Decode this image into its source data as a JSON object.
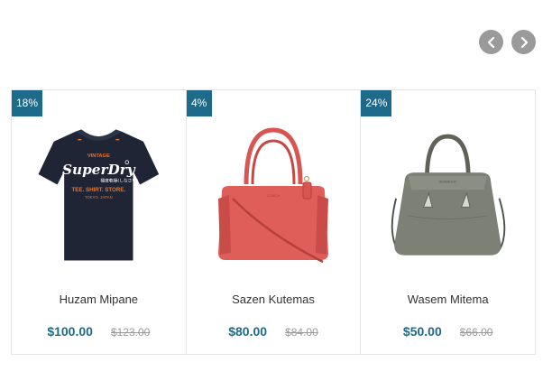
{
  "nav": {
    "prev_icon": "chevron-left-icon",
    "next_icon": "chevron-right-icon",
    "button_color": "#9a9a9a"
  },
  "colors": {
    "accent": "#1d6a8a",
    "badge_text": "#ffffff",
    "old_price": "#9a9a9a"
  },
  "products": [
    {
      "badge": "18%",
      "name": "Huzam Mipane",
      "price": "$100.00",
      "old_price": "$123.00",
      "image": "tshirt-image"
    },
    {
      "badge": "4%",
      "name": "Sazen Kutemas",
      "price": "$80.00",
      "old_price": "$84.00",
      "image": "red-handbag-image"
    },
    {
      "badge": "24%",
      "name": "Wasem Mitema",
      "price": "$50.00",
      "old_price": "$66.00",
      "image": "gray-handbag-image"
    }
  ]
}
